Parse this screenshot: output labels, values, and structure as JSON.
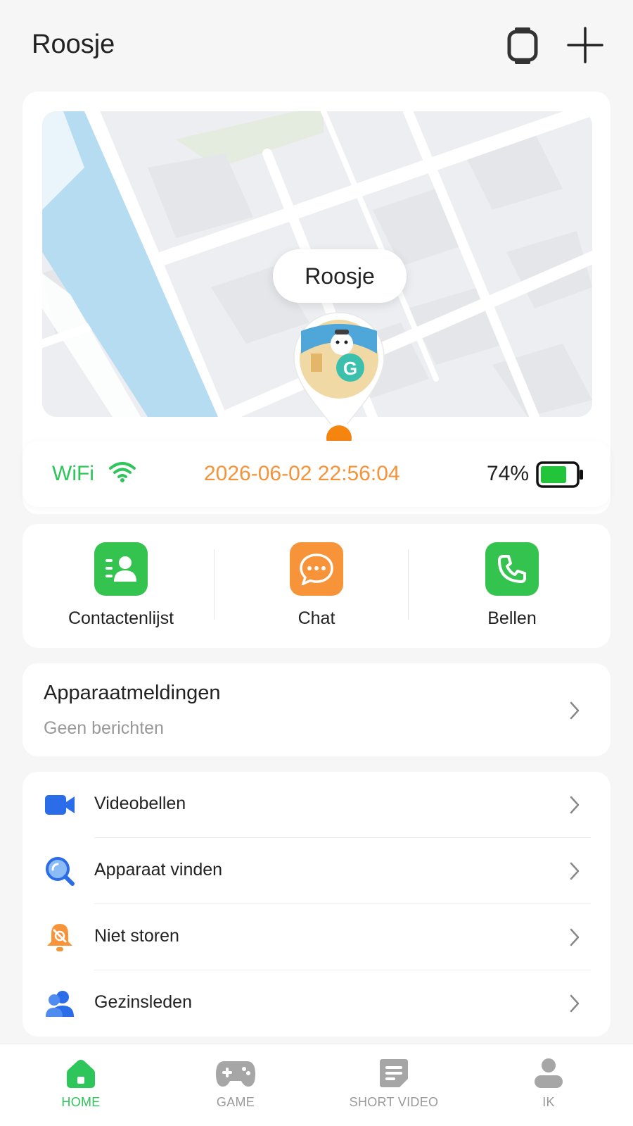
{
  "header": {
    "title": "Roosje",
    "watch_icon": "smartwatch-icon",
    "add_icon": "plus-icon"
  },
  "map": {
    "pin_label": "Roosje",
    "pin_avatar_icon": "child-avatar-icon",
    "location_dot_color": "#f5850f"
  },
  "status": {
    "connection": "WiFi",
    "timestamp": "2026-06-02 22:56:04",
    "battery_percent": "74%",
    "battery_level": 0.74,
    "connection_color": "#2ec55a",
    "timestamp_color": "#f5933a"
  },
  "actions": [
    {
      "label": "Contactenlijst",
      "icon": "contacts-icon",
      "color": "#35c34f"
    },
    {
      "label": "Chat",
      "icon": "chat-bubble-icon",
      "color": "#f7943a"
    },
    {
      "label": "Bellen",
      "icon": "phone-icon",
      "color": "#35c34f"
    }
  ],
  "notifications": {
    "title": "Apparaatmeldingen",
    "subtitle": "Geen berichten"
  },
  "menu": [
    {
      "label": "Videobellen",
      "icon": "video-camera-icon",
      "color": "#2b6de8"
    },
    {
      "label": "Apparaat vinden",
      "icon": "search-icon",
      "color": "#2b6de8"
    },
    {
      "label": "Niet storen",
      "icon": "bell-off-icon",
      "color": "#f7943a"
    },
    {
      "label": "Gezinsleden",
      "icon": "family-icon",
      "color": "#2b6de8"
    }
  ],
  "bottom_nav": [
    {
      "label": "HOME",
      "icon": "home-icon",
      "active": true
    },
    {
      "label": "GAME",
      "icon": "gamepad-icon",
      "active": false
    },
    {
      "label": "SHORT VIDEO",
      "icon": "short-video-icon",
      "active": false
    },
    {
      "label": "IK",
      "icon": "profile-icon",
      "active": false
    }
  ],
  "colors": {
    "accent_green": "#2ec55a",
    "accent_orange": "#f5933a",
    "accent_blue": "#2b6de8",
    "background": "#f6f6f6"
  }
}
